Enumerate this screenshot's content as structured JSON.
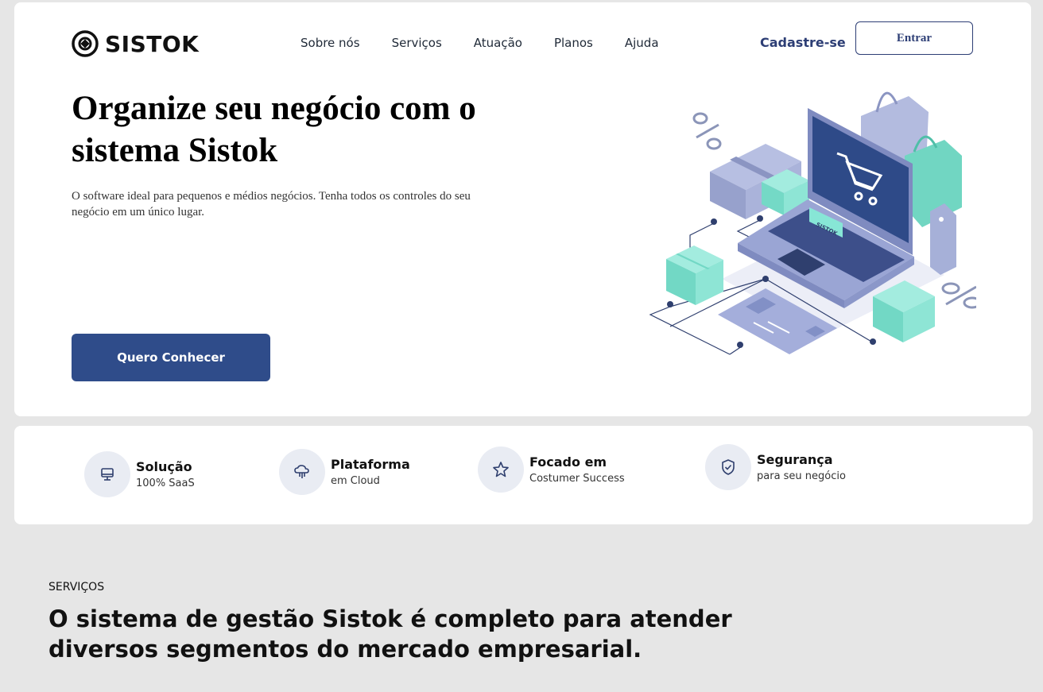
{
  "brand": {
    "name": "SISTOK"
  },
  "nav": {
    "items": [
      {
        "label": "Sobre nós"
      },
      {
        "label": "Serviços"
      },
      {
        "label": "Atuação"
      },
      {
        "label": "Planos"
      },
      {
        "label": "Ajuda"
      }
    ],
    "signup_label": "Cadastre-se",
    "login_label": "Entrar"
  },
  "hero": {
    "title": "Organize seu negócio com o sistema Sistok",
    "subtitle": "O software ideal para pequenos e médios negócios. Tenha todos os controles do seu negócio em um único lugar.",
    "cta_label": "Quero Conhecer",
    "laptop_label": "SISTOK"
  },
  "features": [
    {
      "title": "Solução",
      "subtitle": "100% SaaS",
      "icon": "monitor-icon"
    },
    {
      "title": "Plataforma",
      "subtitle": "em Cloud",
      "icon": "cloud-icon"
    },
    {
      "title": "Focado em",
      "subtitle": "Costumer Success",
      "icon": "star-icon"
    },
    {
      "title": "Segurança",
      "subtitle": "para seu negócio",
      "icon": "shield-icon"
    }
  ],
  "services": {
    "eyebrow": "SERVIÇOS",
    "title": "O sistema de gestão Sistok é completo para atender diversos segmentos do mercado empresarial."
  },
  "colors": {
    "primary": "#2f4c8a",
    "accent_text": "#2d3e75",
    "background": "#e6e6e6",
    "mint": "#7fe0cf",
    "lavender": "#a9b3dc"
  }
}
